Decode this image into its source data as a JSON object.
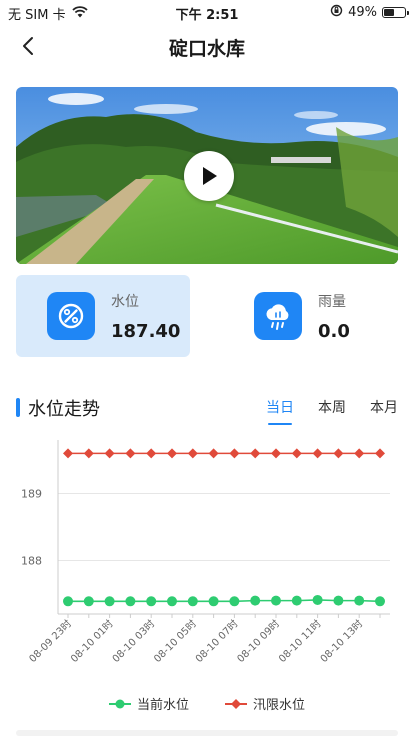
{
  "status_bar": {
    "carrier": "无 SIM 卡",
    "time": "下午 2:51",
    "battery": "49%",
    "battery_level": 0.49
  },
  "nav": {
    "title": "碇口水库"
  },
  "stats": [
    {
      "label": "水位",
      "value": "187.40"
    },
    {
      "label": "雨量",
      "value": "0.0"
    }
  ],
  "section": {
    "title": "水位走势"
  },
  "tabs": [
    "当日",
    "本周",
    "本月"
  ],
  "active_tab": "当日",
  "colors": {
    "accent": "#1f86f5",
    "current_series": "#2ecc71",
    "limit_series": "#e04a3a"
  },
  "chart_data": {
    "type": "line",
    "x": [
      "08-09 23时",
      "08-10 00时",
      "08-10 01时",
      "08-10 02时",
      "08-10 03时",
      "08-10 04时",
      "08-10 05时",
      "08-10 06时",
      "08-10 07时",
      "08-10 08时",
      "08-10 09时",
      "08-10 10时",
      "08-10 11时",
      "08-10 12时",
      "08-10 13时",
      "08-10 14时"
    ],
    "x_tick_labels": [
      "08-09 23时",
      "08-10 01时",
      "08-10 03时",
      "08-10 05时",
      "08-10 07时",
      "08-10 09时",
      "08-10 11时",
      "08-10 13时"
    ],
    "series": [
      {
        "name": "当前水位",
        "values": [
          187.39,
          187.39,
          187.39,
          187.39,
          187.39,
          187.39,
          187.39,
          187.39,
          187.39,
          187.4,
          187.4,
          187.4,
          187.41,
          187.4,
          187.4,
          187.39
        ]
      },
      {
        "name": "汛限水位",
        "values": [
          189.6,
          189.6,
          189.6,
          189.6,
          189.6,
          189.6,
          189.6,
          189.6,
          189.6,
          189.6,
          189.6,
          189.6,
          189.6,
          189.6,
          189.6,
          189.6
        ]
      }
    ],
    "ylim": [
      187.2,
      189.8
    ],
    "y_ticks": [
      188,
      189
    ],
    "grid": true,
    "legend": "bottom-center"
  }
}
